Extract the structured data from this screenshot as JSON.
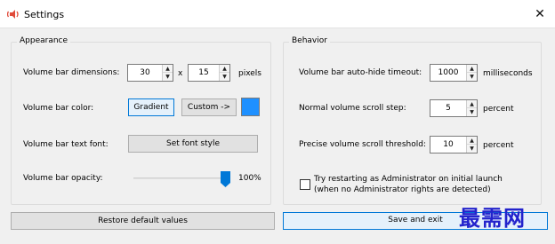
{
  "window": {
    "title": "Settings",
    "app_icon": "speaker-volume-icon",
    "close_glyph": "✕"
  },
  "appearance": {
    "group_title": "Appearance",
    "dimensions_label": "Volume bar dimensions:",
    "width_value": "30",
    "times_label": "x",
    "height_value": "15",
    "dimensions_unit": "pixels",
    "color_label": "Volume bar color:",
    "gradient_button": "Gradient",
    "custom_button": "Custom ->",
    "custom_color": "#1e90ff",
    "font_label": "Volume bar text font:",
    "font_button": "Set font style",
    "opacity_label": "Volume bar opacity:",
    "opacity_percent": 100,
    "opacity_text": "100%"
  },
  "behavior": {
    "group_title": "Behavior",
    "autohide_label": "Volume bar auto-hide timeout:",
    "autohide_value": "1000",
    "autohide_unit": "milliseconds",
    "normal_label": "Normal volume scroll step:",
    "normal_value": "5",
    "normal_unit": "percent",
    "precise_label": "Precise volume scroll threshold:",
    "precise_value": "10",
    "precise_unit": "percent",
    "admin_checkbox_line1": "Try restarting as Administrator on initial launch",
    "admin_checkbox_line2": "(when no Administrator rights are detected)",
    "admin_checked": false
  },
  "footer": {
    "restore_button": "Restore default values",
    "save_button": "Save and exit"
  },
  "colors": {
    "accent": "#0078d7",
    "thumb": "#0078d7"
  },
  "watermark": {
    "text": "最需网"
  }
}
